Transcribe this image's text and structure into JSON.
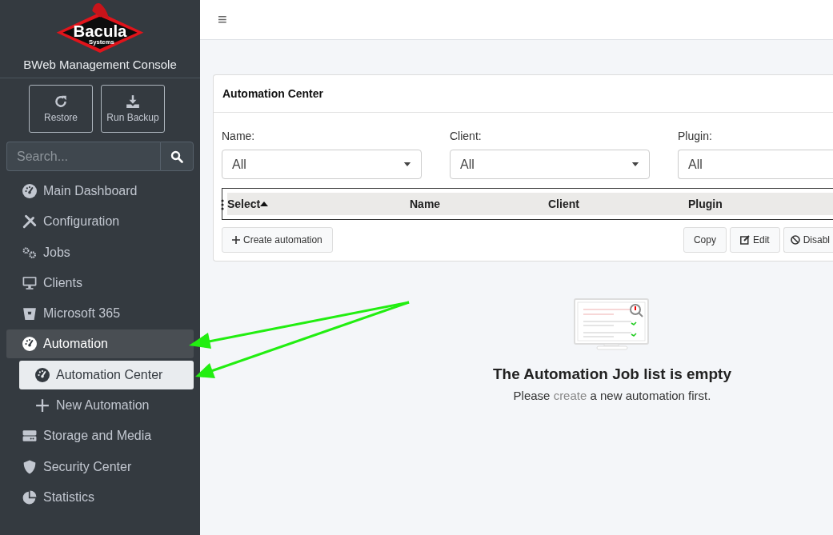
{
  "brand": {
    "logo_word": "Bacula",
    "logo_sub": "Systems",
    "title": "BWeb Management Console"
  },
  "quick_actions": [
    {
      "label": "Restore",
      "kind": "restore"
    },
    {
      "label": "Run Backup",
      "kind": "backup"
    }
  ],
  "search": {
    "placeholder": "Search..."
  },
  "sidebar": {
    "items": [
      {
        "label": "Main Dashboard",
        "kind": "gauge",
        "selected": false
      },
      {
        "label": "Configuration",
        "kind": "tools",
        "selected": false
      },
      {
        "label": "Jobs",
        "kind": "gears",
        "selected": false
      },
      {
        "label": "Clients",
        "kind": "monitor",
        "selected": false
      },
      {
        "label": "Microsoft 365",
        "kind": "bucket",
        "selected": false
      },
      {
        "label": "Automation",
        "kind": "gauge",
        "selected": false,
        "expanded": true,
        "children": [
          {
            "label": "Automation Center",
            "kind": "gauge",
            "selected": true
          },
          {
            "label": "New Automation",
            "kind": "plus",
            "selected": false
          }
        ]
      },
      {
        "label": "Storage and Media",
        "kind": "drive",
        "selected": false
      },
      {
        "label": "Security Center",
        "kind": "shield",
        "selected": false
      },
      {
        "label": "Statistics",
        "kind": "pie",
        "selected": false
      }
    ]
  },
  "topbar": {
    "menu_icon": "≡"
  },
  "card": {
    "title": "Automation Center",
    "filters": [
      {
        "label": "Name:",
        "value": "All",
        "dropdown": true
      },
      {
        "label": "Client:",
        "value": "All",
        "dropdown": true
      },
      {
        "label": "Plugin:",
        "value": "All",
        "dropdown": false
      }
    ],
    "table": {
      "columns": [
        {
          "label": "Select",
          "sorted": true
        },
        {
          "label": "Name",
          "sorted": false
        },
        {
          "label": "Client",
          "sorted": false
        },
        {
          "label": "Plugin",
          "sorted": false
        }
      ]
    },
    "create_button": "Create automation",
    "actions": [
      {
        "label": "Copy",
        "kind": "copy"
      },
      {
        "label": "Edit",
        "kind": "edit"
      },
      {
        "label": "Disabl",
        "kind": "disable"
      }
    ]
  },
  "empty_state": {
    "title": "The Automation Job list is empty",
    "before": "Please ",
    "link": "create",
    "after": " a new automation first."
  }
}
